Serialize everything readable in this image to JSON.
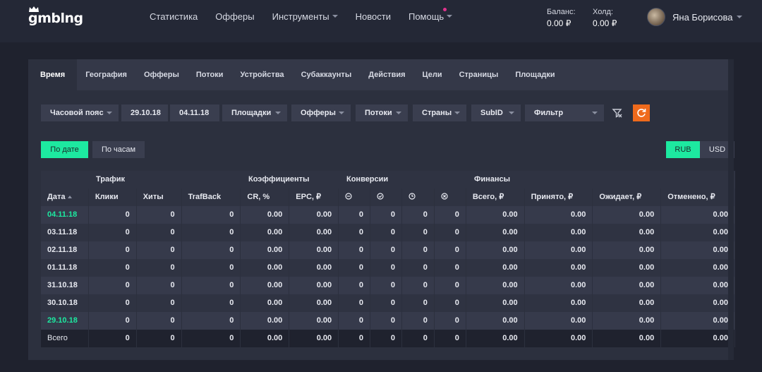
{
  "logo": "gmblng",
  "nav": [
    {
      "label": "Статистика",
      "dropdown": false,
      "dot": false
    },
    {
      "label": "Офферы",
      "dropdown": false,
      "dot": false
    },
    {
      "label": "Инструменты",
      "dropdown": true,
      "dot": false
    },
    {
      "label": "Новости",
      "dropdown": false,
      "dot": false
    },
    {
      "label": "Помощь",
      "dropdown": true,
      "dot": true
    }
  ],
  "balance": {
    "label": "Баланс:",
    "value": "0.00 ₽"
  },
  "hold": {
    "label": "Холд:",
    "value": "0.00 ₽"
  },
  "user": {
    "name": "Яна Борисова"
  },
  "tabs": [
    "Время",
    "География",
    "Офферы",
    "Потоки",
    "Устройства",
    "Субаккаунты",
    "Действия",
    "Цели",
    "Страницы",
    "Площадки"
  ],
  "filters": {
    "timezone": "Часовой пояс",
    "date_from": "29.10.18",
    "date_to": "04.11.18",
    "platforms": "Площадки",
    "offers": "Офферы",
    "streams": "Потоки",
    "countries": "Страны",
    "subid": "SubID",
    "filter": "Фильтр"
  },
  "modes": {
    "by_date": "По дате",
    "by_hours": "По часам"
  },
  "currency": {
    "rub": "RUB",
    "usd": "USD"
  },
  "table": {
    "groups": {
      "traffic": "Трафик",
      "ratios": "Коэффициенты",
      "conversions": "Конверсии",
      "finance": "Финансы"
    },
    "columns": [
      "Дата",
      "Клики",
      "Хиты",
      "TrafBack",
      "CR, %",
      "EPC, ₽",
      "",
      "",
      "",
      "",
      "Всего, ₽",
      "Принято, ₽",
      "Ожидает, ₽",
      "Отменено, ₽"
    ],
    "conversion_icons": [
      "minus-circle-icon",
      "check-circle-icon",
      "clock-icon",
      "cancel-circle-icon"
    ],
    "rows": [
      {
        "date": "04.11.18",
        "highlight": true,
        "values": [
          "0",
          "0",
          "0",
          "0.00",
          "0.00",
          "0",
          "0",
          "0",
          "0",
          "0.00",
          "0.00",
          "0.00",
          "0.00"
        ]
      },
      {
        "date": "03.11.18",
        "highlight": false,
        "values": [
          "0",
          "0",
          "0",
          "0.00",
          "0.00",
          "0",
          "0",
          "0",
          "0",
          "0.00",
          "0.00",
          "0.00",
          "0.00"
        ]
      },
      {
        "date": "02.11.18",
        "highlight": false,
        "values": [
          "0",
          "0",
          "0",
          "0.00",
          "0.00",
          "0",
          "0",
          "0",
          "0",
          "0.00",
          "0.00",
          "0.00",
          "0.00"
        ]
      },
      {
        "date": "01.11.18",
        "highlight": false,
        "values": [
          "0",
          "0",
          "0",
          "0.00",
          "0.00",
          "0",
          "0",
          "0",
          "0",
          "0.00",
          "0.00",
          "0.00",
          "0.00"
        ]
      },
      {
        "date": "31.10.18",
        "highlight": false,
        "values": [
          "0",
          "0",
          "0",
          "0.00",
          "0.00",
          "0",
          "0",
          "0",
          "0",
          "0.00",
          "0.00",
          "0.00",
          "0.00"
        ]
      },
      {
        "date": "30.10.18",
        "highlight": false,
        "values": [
          "0",
          "0",
          "0",
          "0.00",
          "0.00",
          "0",
          "0",
          "0",
          "0",
          "0.00",
          "0.00",
          "0.00",
          "0.00"
        ]
      },
      {
        "date": "29.10.18",
        "highlight": true,
        "values": [
          "0",
          "0",
          "0",
          "0.00",
          "0.00",
          "0",
          "0",
          "0",
          "0",
          "0.00",
          "0.00",
          "0.00",
          "0.00"
        ]
      }
    ],
    "total": {
      "label": "Всего",
      "values": [
        "0",
        "0",
        "0",
        "0.00",
        "0.00",
        "0",
        "0",
        "0",
        "0",
        "0.00",
        "0.00",
        "0.00",
        "0.00"
      ]
    }
  }
}
